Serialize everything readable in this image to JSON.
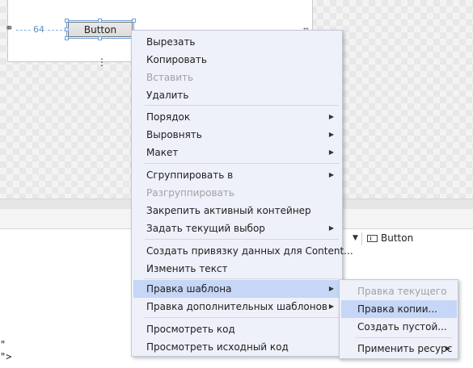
{
  "designer": {
    "margin_value": "64",
    "button_content": "Button",
    "icons": {
      "chain": "margin-link-icon",
      "anchor_right": "anchor-right-icon",
      "anchor_bottom": "anchor-bottom-icon"
    }
  },
  "breadcrumb": {
    "element_label": "Button",
    "icon": "button-element-icon"
  },
  "xaml_lines": [
    {
      "text": "\""
    },
    {
      "text": "\">"
    }
  ],
  "context_menu": {
    "items": [
      {
        "label": "Вырезать"
      },
      {
        "label": "Копировать"
      },
      {
        "label": "Вставить"
      },
      {
        "label": "Удалить"
      },
      {
        "label": "Порядок"
      },
      {
        "label": "Выровнять"
      },
      {
        "label": "Макет"
      },
      {
        "label": "Сгруппировать в"
      },
      {
        "label": "Разгруппировать"
      },
      {
        "label": "Закрепить активный контейнер"
      },
      {
        "label": "Задать текущий выбор"
      },
      {
        "label": "Создать привязку данных для Content..."
      },
      {
        "label": "Изменить текст"
      },
      {
        "label": "Правка шаблона"
      },
      {
        "label": "Правка дополнительных шаблонов"
      },
      {
        "label": "Просмотреть код"
      },
      {
        "label": "Просмотреть исходный код"
      }
    ]
  },
  "submenu": {
    "items": [
      {
        "label": "Правка текущего"
      },
      {
        "label": "Правка копии..."
      },
      {
        "label": "Создать пустой..."
      },
      {
        "label": "Применить ресурс"
      }
    ]
  },
  "colors": {
    "menu_background": "#eef0fa",
    "menu_highlight": "#c5d6f6",
    "selection_accent": "#6c9ed6",
    "disabled_text": "#a2a2a2"
  }
}
